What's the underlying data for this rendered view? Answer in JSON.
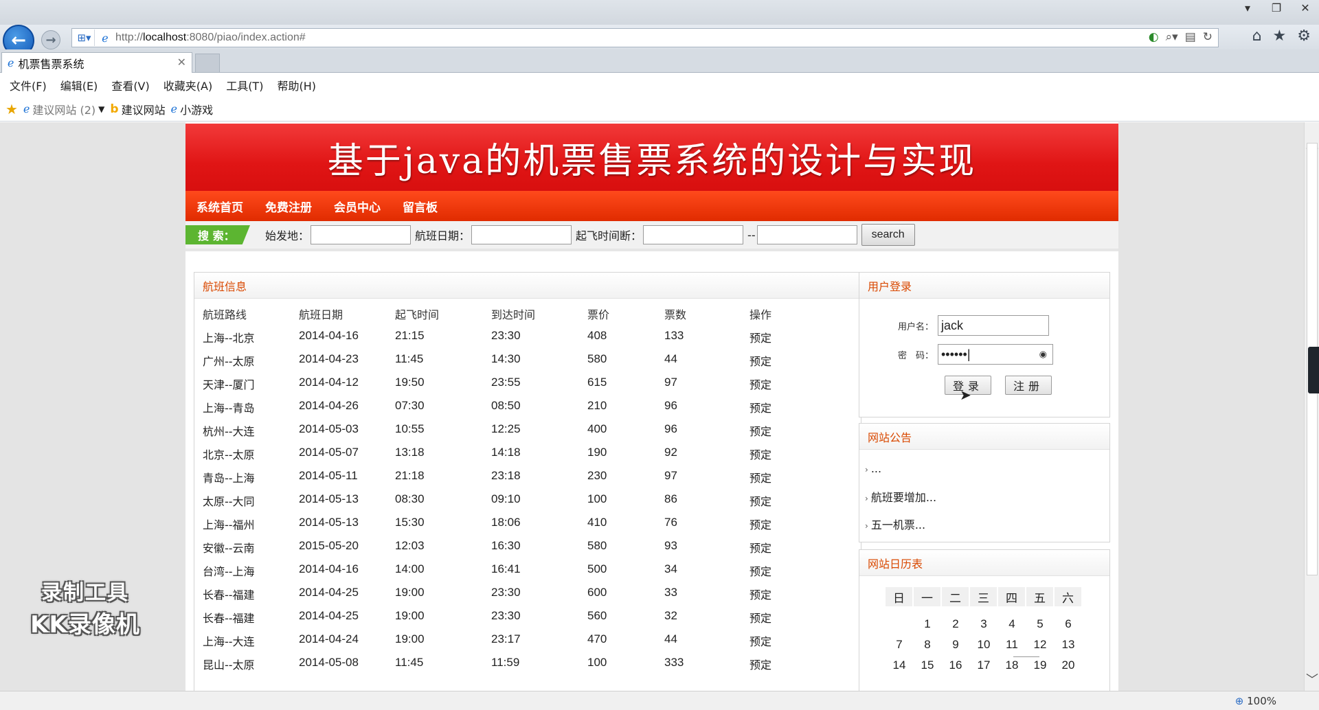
{
  "browser": {
    "url_prefix": "http://",
    "url_host": "localhost",
    "url_rest": ":8080/piao/index.action#",
    "tab_title": "机票售票系统",
    "zoom": "100%",
    "menu": [
      "文件(F)",
      "编辑(E)",
      "查看(V)",
      "收藏夹(A)",
      "工具(T)",
      "帮助(H)"
    ],
    "favorites": {
      "suggested_sites_count": "建议网站 (2)",
      "suggested_sites": "建议网站",
      "games": "小游戏"
    }
  },
  "site": {
    "title": "基于java的机票售票系统的设计与实现",
    "nav": [
      "系统首页",
      "免费注册",
      "会员中心",
      "留言板"
    ],
    "search": {
      "tag": "搜 索：",
      "origin_label": "始发地：",
      "date_label": "航班日期：",
      "time_label": "起飞时间断：",
      "separator": "--",
      "button": "search"
    },
    "flights": {
      "heading": "航班信息",
      "columns": [
        "航班路线",
        "航班日期",
        "起飞时间",
        "到达时间",
        "票价",
        "票数",
        "操作"
      ],
      "rows": [
        [
          "上海--北京",
          "2014-04-16",
          "21:15",
          "23:30",
          "408",
          "133",
          "预定"
        ],
        [
          "广州--太原",
          "2014-04-23",
          "11:45",
          "14:30",
          "580",
          "44",
          "预定"
        ],
        [
          "天津--厦门",
          "2014-04-12",
          "19:50",
          "23:55",
          "615",
          "97",
          "预定"
        ],
        [
          "上海--青岛",
          "2014-04-26",
          "07:30",
          "08:50",
          "210",
          "96",
          "预定"
        ],
        [
          "杭州--大连",
          "2014-05-03",
          "10:55",
          "12:25",
          "400",
          "96",
          "预定"
        ],
        [
          "北京--太原",
          "2014-05-07",
          "13:18",
          "14:18",
          "190",
          "92",
          "预定"
        ],
        [
          "青岛--上海",
          "2014-05-11",
          "21:18",
          "23:18",
          "230",
          "97",
          "预定"
        ],
        [
          "太原--大同",
          "2014-05-13",
          "08:30",
          "09:10",
          "100",
          "86",
          "预定"
        ],
        [
          "上海--福州",
          "2014-05-13",
          "15:30",
          "18:06",
          "410",
          "76",
          "预定"
        ],
        [
          "安徽--云南",
          "2015-05-20",
          "12:03",
          "16:30",
          "580",
          "93",
          "预定"
        ],
        [
          "台湾--上海",
          "2014-04-16",
          "14:00",
          "16:41",
          "500",
          "34",
          "预定"
        ],
        [
          "长春--福建",
          "2014-04-25",
          "19:00",
          "23:30",
          "600",
          "33",
          "预定"
        ],
        [
          "长春--福建",
          "2014-04-25",
          "19:00",
          "23:30",
          "560",
          "32",
          "预定"
        ],
        [
          "上海--大连",
          "2014-04-24",
          "19:00",
          "23:17",
          "470",
          "44",
          "预定"
        ],
        [
          "昆山--太原",
          "2014-05-08",
          "11:45",
          "11:59",
          "100",
          "333",
          "预定"
        ]
      ]
    },
    "login": {
      "heading": "用户登录",
      "username_label": "用户名：",
      "username_value": "jack",
      "password_label": "密　码：",
      "password_value": "••••••",
      "login_button": "登录",
      "register_button": "注册"
    },
    "notices": {
      "heading": "网站公告",
      "items": [
        "...",
        "航班要增加...",
        "五一机票..."
      ]
    },
    "calendar": {
      "heading": "网站日历表",
      "weekdays": [
        "日",
        "一",
        "二",
        "三",
        "四",
        "五",
        "六"
      ],
      "weeks": [
        [
          "",
          "1",
          "2",
          "3",
          "4",
          "5",
          "6"
        ],
        [
          "7",
          "8",
          "9",
          "10",
          "11",
          "12",
          "13"
        ],
        [
          "14",
          "15",
          "16",
          "17",
          "18",
          "19",
          "20"
        ]
      ]
    }
  },
  "watermark": {
    "line1": "录制工具",
    "line2": "KK录像机"
  }
}
